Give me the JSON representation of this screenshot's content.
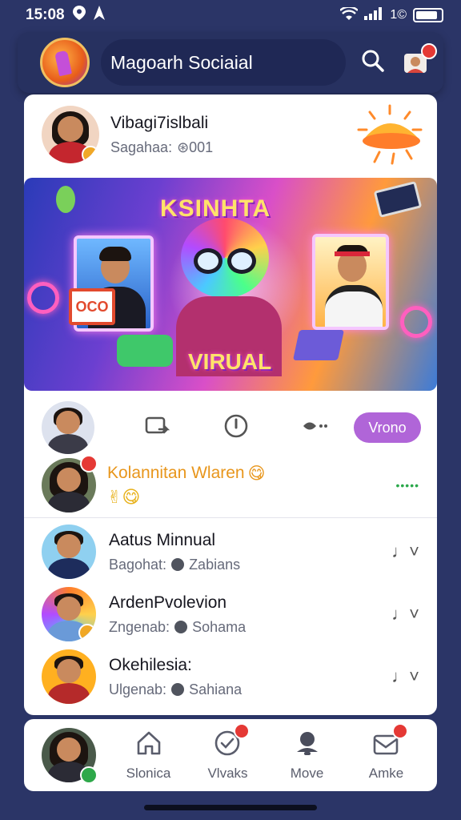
{
  "status_bar": {
    "time": "15:08",
    "battery_text": "1©"
  },
  "header": {
    "app_title": "Magoarh Sociaial"
  },
  "feature_post": {
    "name": "Vibagi7islbali",
    "subtitle_prefix": "Sagahaa:",
    "subtitle_value": "⊛001"
  },
  "banner": {
    "title": "KSINHTA",
    "subtitle": "VIRUAL",
    "sign_text": "OCO"
  },
  "action_row": {
    "pill_label": "Vrono"
  },
  "highlight_post": {
    "name": "Kolannitan Wlaren",
    "emoji": "😋",
    "sub_icons": "✌😋",
    "dots": "•••••"
  },
  "contacts": [
    {
      "name": "Aatus Minnual",
      "prefix": "Bagohat:",
      "value": "Zabians"
    },
    {
      "name": "ArdenPvolevion",
      "prefix": "Zngenab:",
      "value": "Sohama"
    },
    {
      "name": "Okehilesia:",
      "prefix": "Ulgenab:",
      "value": "Sahiana"
    }
  ],
  "bottom_nav": [
    {
      "label": "Slonica"
    },
    {
      "label": "Vlvaks"
    },
    {
      "label": "Move"
    },
    {
      "label": "Amke"
    }
  ],
  "colors": {
    "background": "#2b3567",
    "accent_purple": "#b065d8",
    "badge_red": "#e53935",
    "highlight_orange": "#e8961c"
  }
}
